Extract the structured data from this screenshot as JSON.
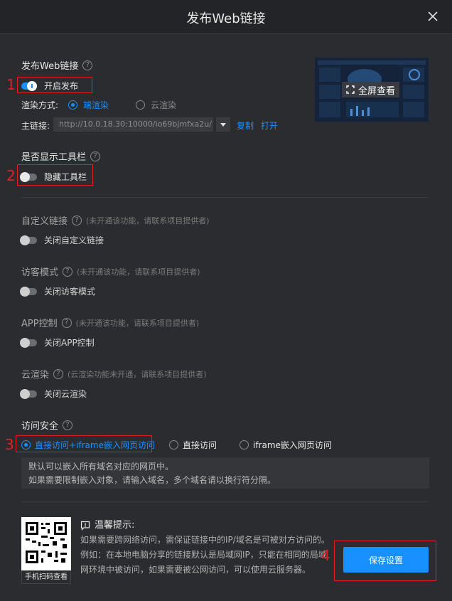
{
  "dialog": {
    "title": "发布Web链接"
  },
  "publish": {
    "section_title": "发布Web链接",
    "toggle_label": "开启发布",
    "render_mode_label": "渲染方式:",
    "render_options": [
      "端渲染",
      "云渲染"
    ],
    "main_link_label": "主链接:",
    "main_link_value": "http://10.0.18.30:10000/io69bjmfxa2u/",
    "copy_label": "复制",
    "open_label": "打开",
    "preview_button": "全屏查看"
  },
  "toolbar": {
    "section_title": "是否显示工具栏",
    "toggle_label": "隐藏工具栏"
  },
  "custom_link": {
    "section_title": "自定义链接",
    "note": "(未开通该功能，请联系项目提供者)",
    "toggle_label": "关闭自定义链接"
  },
  "guest_mode": {
    "section_title": "访客模式",
    "note": "(未开通该功能，请联系项目提供者)",
    "toggle_label": "关闭访客模式"
  },
  "app_control": {
    "section_title": "APP控制",
    "note": "(未开通该功能，请联系项目提供者)",
    "toggle_label": "关闭APP控制"
  },
  "cloud_render": {
    "section_title": "云渲染",
    "note": "(云渲染功能未开通，请联系项目提供者)",
    "toggle_label": "关闭云渲染"
  },
  "access_security": {
    "section_title": "访问安全",
    "options": [
      "直接访问+iframe嵌入网页访问",
      "直接访问",
      "iframe嵌入网页访问"
    ],
    "textarea_line1": "默认可以嵌入所有域名对应的网页中。",
    "textarea_line2": "如果需要限制嵌入对象，请输入域名，多个域名请以换行符分隔。"
  },
  "footer": {
    "qr_label": "手机扫码查看",
    "tip_title": "温馨提示:",
    "tip_line1": "如果需要跨网络访问，需保证链接中的IP/域名是可被对方访问的。",
    "tip_line2": "例如：在本地电脑分享的链接默认是局域网IP，只能在相同的局域",
    "tip_line3": "网环境中被访问，如果需要被公网访问，可以使用云服务器。",
    "save_button": "保存设置"
  },
  "annotations": [
    "1",
    "2",
    "3",
    "4"
  ],
  "colors": {
    "accent": "#1890ff",
    "annotation": "#e02020",
    "background": "#2b2c2f"
  }
}
